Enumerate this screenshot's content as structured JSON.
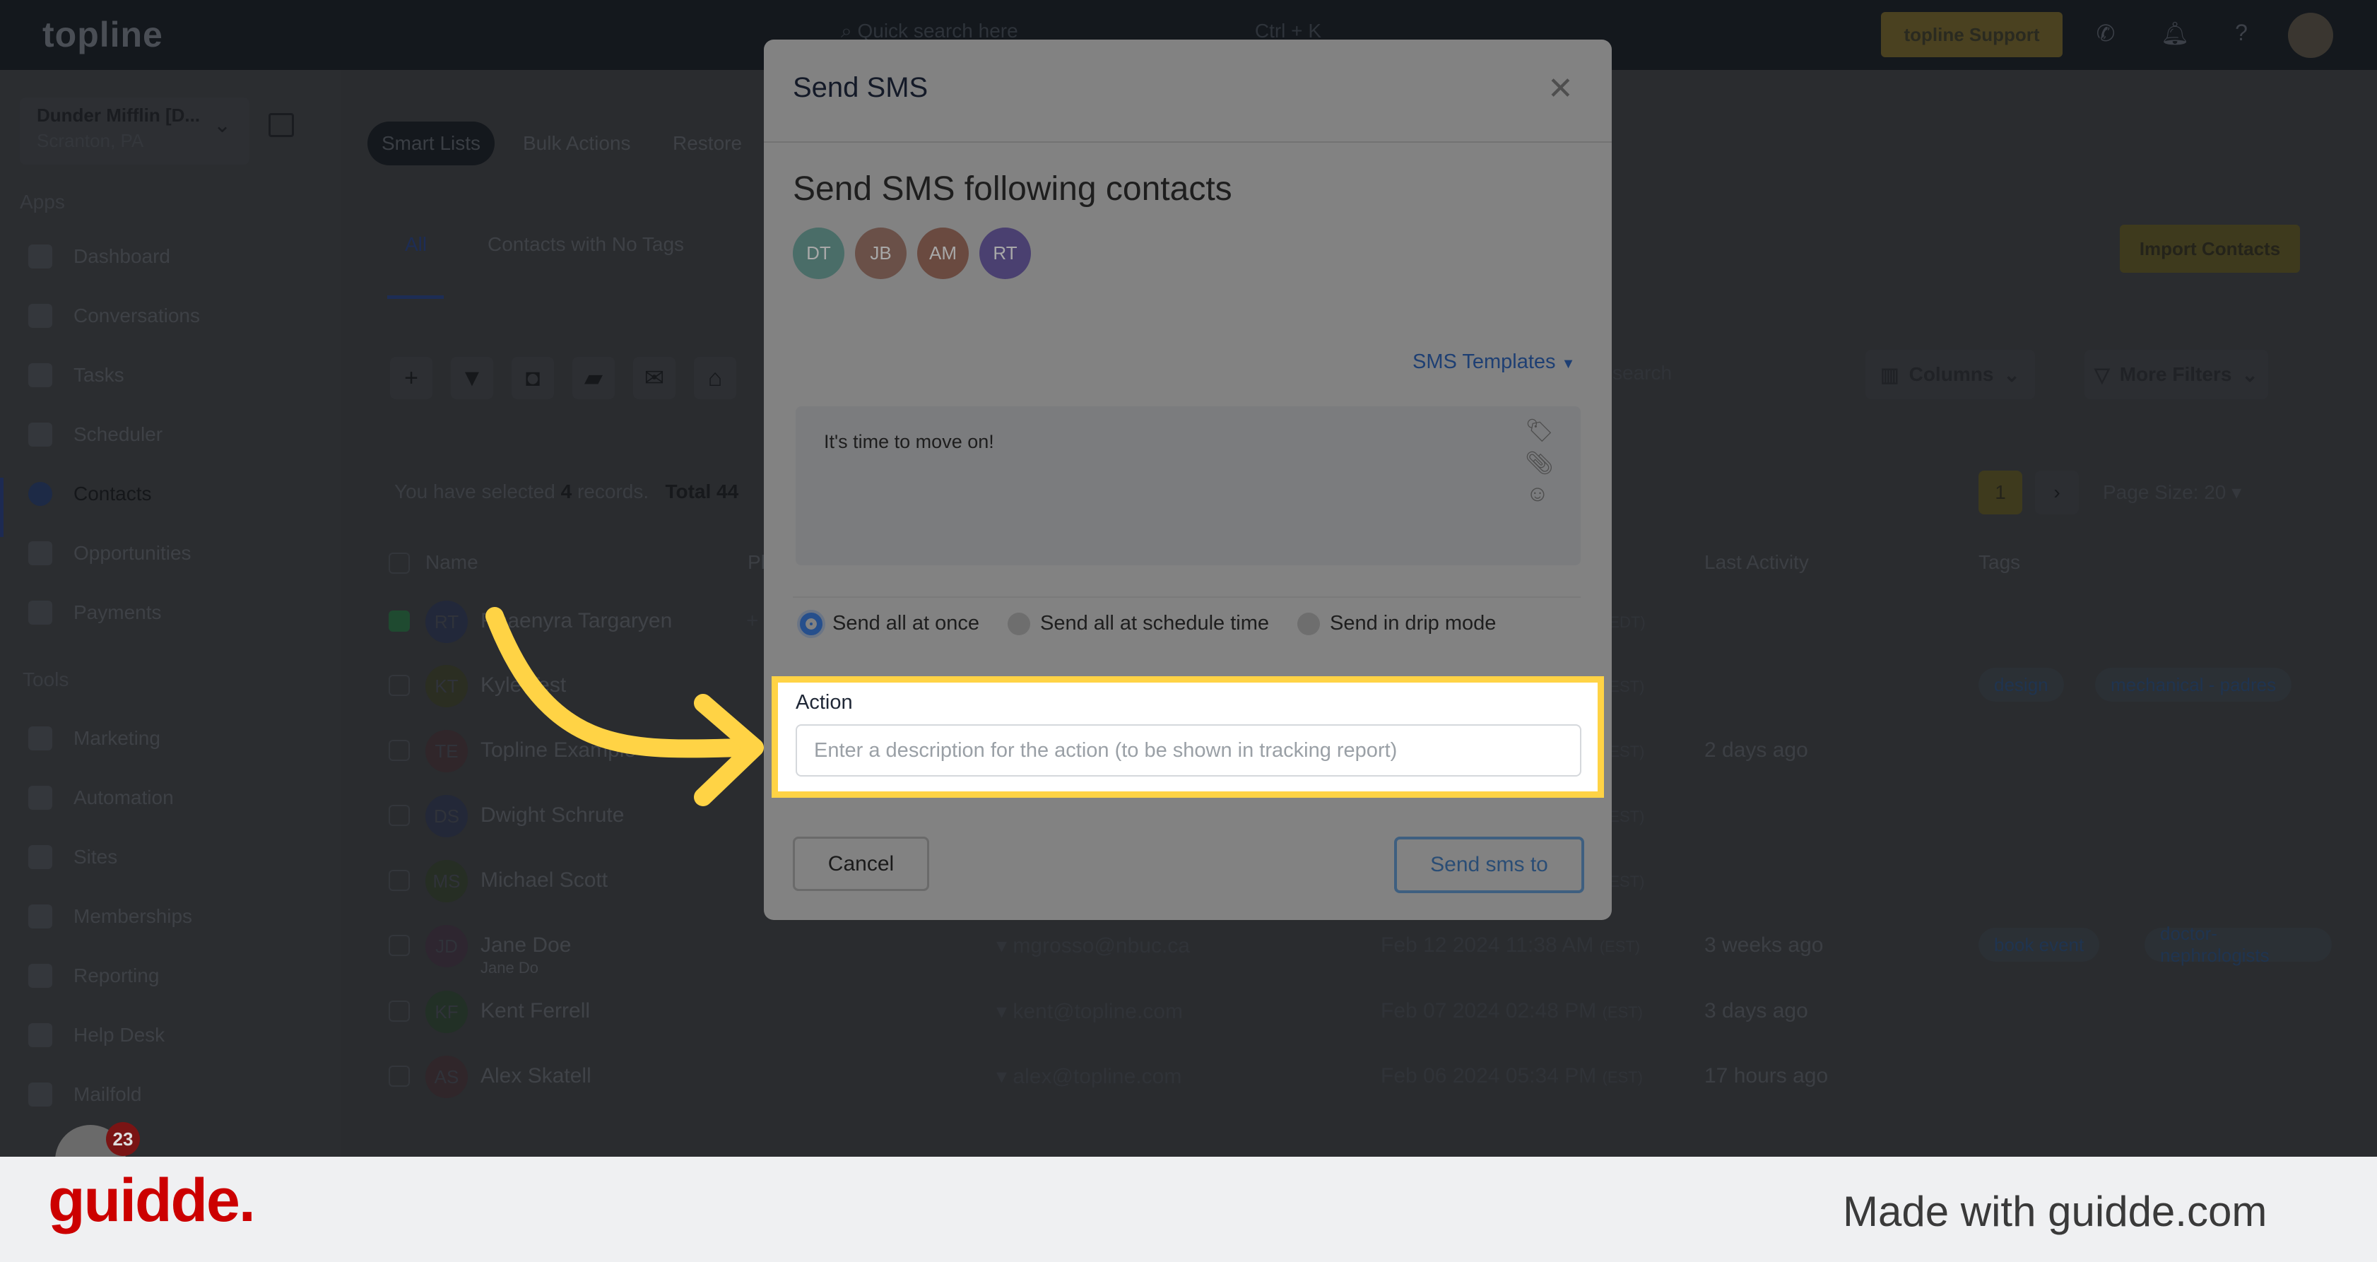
{
  "topbar": {
    "logo": "topline",
    "search_placeholder": "Quick search here",
    "search_shortcut": "Ctrl + K",
    "support_label": "topline Support"
  },
  "account": {
    "name": "Dunder Mifflin [D...",
    "location": "Scranton, PA"
  },
  "sidebar": {
    "apps_label": "Apps",
    "apps": [
      {
        "label": "Dashboard"
      },
      {
        "label": "Conversations"
      },
      {
        "label": "Tasks"
      },
      {
        "label": "Scheduler"
      },
      {
        "label": "Contacts",
        "active": true
      },
      {
        "label": "Opportunities"
      },
      {
        "label": "Payments"
      }
    ],
    "tools_label": "Tools",
    "tools": [
      {
        "label": "Marketing"
      },
      {
        "label": "Automation"
      },
      {
        "label": "Sites"
      },
      {
        "label": "Memberships"
      },
      {
        "label": "Reporting"
      },
      {
        "label": "Help Desk"
      },
      {
        "label": "Mailfold"
      }
    ],
    "notification_count": "23"
  },
  "contacts": {
    "top_tabs": [
      "Smart Lists",
      "Bulk Actions",
      "Restore"
    ],
    "list_tabs": [
      "All",
      "Contacts with No Tags"
    ],
    "import_label": "Import Contacts",
    "search_placeholder": "search",
    "columns_label": "Columns",
    "more_filters_label": "More Filters",
    "selection": {
      "prefix": "You have selected",
      "count": "4",
      "suffix": "records.",
      "total": "Total 44"
    },
    "page": "1",
    "page_size": "Page Size: 20",
    "headers": {
      "name": "Name",
      "phone": "Ph",
      "last_activity": "Last Activity",
      "tags": "Tags"
    },
    "rows": [
      {
        "initials": "RT",
        "name": "Rhaenyra Targaryen",
        "phone": "+",
        "tz": "(EDT)",
        "checked": true,
        "color": "#22283a"
      },
      {
        "initials": "KT",
        "name": "Kyle Test",
        "tz": "(EST)",
        "tags": [
          "design",
          "mechanical - padres"
        ],
        "color": "#2b2e22"
      },
      {
        "initials": "TE",
        "name": "Topline Example",
        "tz": "(EST)",
        "activity": "2 days ago",
        "color": "#30262a"
      },
      {
        "initials": "DS",
        "name": "Dwight Schrute",
        "tz": "(EST)",
        "color": "#232838"
      },
      {
        "initials": "MS",
        "name": "Michael Scott",
        "tz": "(EST)",
        "color": "#262e24"
      },
      {
        "initials": "JD",
        "name": "Jane Doe",
        "sub": "Jane Do",
        "email": "mgrosso@nbuc.ca",
        "date": "Feb 12 2024 11:38 AM",
        "tz": "(EST)",
        "activity": "3 weeks ago",
        "tags": [
          "book event",
          "doctor-nephrologists"
        ],
        "color": "#2e2630"
      },
      {
        "initials": "KF",
        "name": "Kent Ferrell",
        "email": "kent@topline.com",
        "date": "Feb 07 2024 02:48 PM",
        "tz": "(EST)",
        "activity": "3 days ago",
        "color": "#223026"
      },
      {
        "initials": "AS",
        "name": "Alex Skatell",
        "email": "alex@topline.com",
        "date": "Feb 06 2024 05:34 PM",
        "tz": "(EST)",
        "activity": "17 hours ago",
        "color": "#30262a"
      }
    ]
  },
  "modal": {
    "title": "Send SMS",
    "subtitle": "Send SMS following contacts",
    "recipients": [
      {
        "initials": "DT",
        "color": "#4a6d68"
      },
      {
        "initials": "JB",
        "color": "#6a5048"
      },
      {
        "initials": "AM",
        "color": "#6a4a40"
      },
      {
        "initials": "RT",
        "color": "#4a4070"
      }
    ],
    "templates_label": "SMS Templates",
    "message": "It's time to move on!",
    "send_modes": [
      {
        "label": "Send all at once",
        "selected": true
      },
      {
        "label": "Send all at schedule time"
      },
      {
        "label": "Send in drip mode"
      }
    ],
    "action_label": "Action",
    "action_value": "",
    "action_placeholder": "Enter a description for the action (to be shown in tracking report)",
    "cancel_label": "Cancel",
    "send_label": "Send sms to"
  },
  "footer": {
    "logo": "guidde.",
    "tagline": "Made with guidde.com"
  },
  "colors": {
    "highlight": "#ffd345",
    "brand_red": "#cc0000",
    "accent_blue": "#264f8c"
  }
}
